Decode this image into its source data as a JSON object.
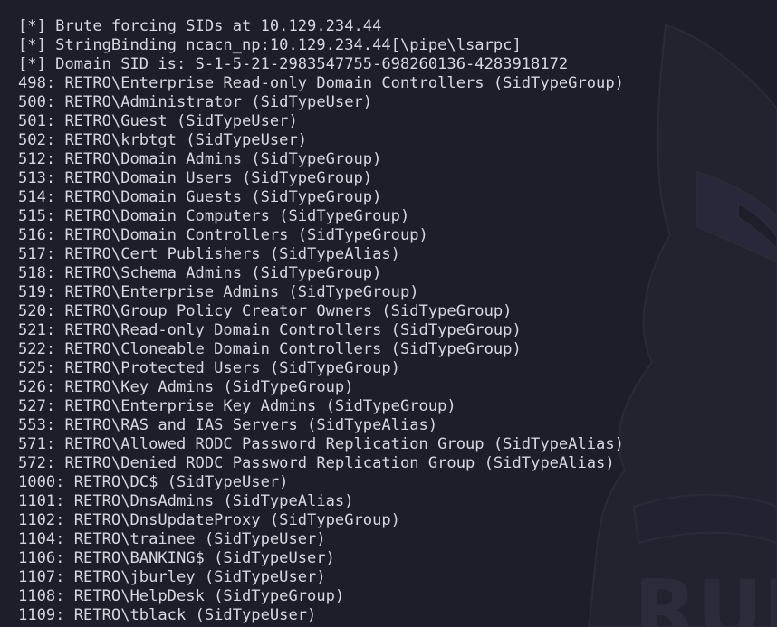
{
  "terminal": {
    "lines": [
      "[*] Brute forcing SIDs at 10.129.234.44",
      "[*] StringBinding ncacn_np:10.129.234.44[\\pipe\\lsarpc]",
      "[*] Domain SID is: S-1-5-21-2983547755-698260136-4283918172",
      "498: RETRO\\Enterprise Read-only Domain Controllers (SidTypeGroup)",
      "500: RETRO\\Administrator (SidTypeUser)",
      "501: RETRO\\Guest (SidTypeUser)",
      "502: RETRO\\krbtgt (SidTypeUser)",
      "512: RETRO\\Domain Admins (SidTypeGroup)",
      "513: RETRO\\Domain Users (SidTypeGroup)",
      "514: RETRO\\Domain Guests (SidTypeGroup)",
      "515: RETRO\\Domain Computers (SidTypeGroup)",
      "516: RETRO\\Domain Controllers (SidTypeGroup)",
      "517: RETRO\\Cert Publishers (SidTypeAlias)",
      "518: RETRO\\Schema Admins (SidTypeGroup)",
      "519: RETRO\\Enterprise Admins (SidTypeGroup)",
      "520: RETRO\\Group Policy Creator Owners (SidTypeGroup)",
      "521: RETRO\\Read-only Domain Controllers (SidTypeGroup)",
      "522: RETRO\\Cloneable Domain Controllers (SidTypeGroup)",
      "525: RETRO\\Protected Users (SidTypeGroup)",
      "526: RETRO\\Key Admins (SidTypeGroup)",
      "527: RETRO\\Enterprise Key Admins (SidTypeGroup)",
      "553: RETRO\\RAS and IAS Servers (SidTypeAlias)",
      "571: RETRO\\Allowed RODC Password Replication Group (SidTypeAlias)",
      "572: RETRO\\Denied RODC Password Replication Group (SidTypeAlias)",
      "1000: RETRO\\DC$ (SidTypeUser)",
      "1101: RETRO\\DnsAdmins (SidTypeAlias)",
      "1102: RETRO\\DnsUpdateProxy (SidTypeGroup)",
      "1104: RETRO\\trainee (SidTypeUser)",
      "1106: RETRO\\BANKING$ (SidTypeUser)",
      "1107: RETRO\\jburley (SidTypeUser)",
      "1108: RETRO\\HelpDesk (SidTypeGroup)",
      "1109: RETRO\\tblack (SidTypeUser)"
    ]
  },
  "colors": {
    "background": "#1d1e29",
    "foreground": "#d6d7e0",
    "watermark": "#262633"
  },
  "icons": {
    "background_art": "cat-mascot-watermark-icon"
  }
}
